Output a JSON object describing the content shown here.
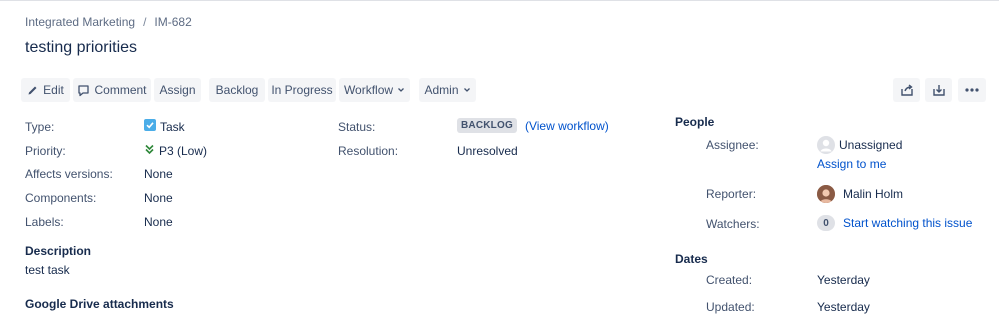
{
  "breadcrumb": {
    "project": "Integrated Marketing",
    "issue_key": "IM-682"
  },
  "issue": {
    "title": "testing priorities"
  },
  "toolbar": {
    "edit": "Edit",
    "comment": "Comment",
    "assign": "Assign",
    "backlog": "Backlog",
    "in_progress": "In Progress",
    "workflow": "Workflow",
    "admin": "Admin"
  },
  "details": {
    "type_label": "Type:",
    "type_value": "Task",
    "priority_label": "Priority:",
    "priority_value": "P3 (Low)",
    "affects_label": "Affects versions:",
    "affects_value": "None",
    "components_label": "Components:",
    "components_value": "None",
    "labels_label": "Labels:",
    "labels_value": "None",
    "status_label": "Status:",
    "status_value": "BACKLOG",
    "view_workflow": "(View workflow)",
    "resolution_label": "Resolution:",
    "resolution_value": "Unresolved"
  },
  "description": {
    "heading": "Description",
    "text": "test task"
  },
  "gdrive": {
    "heading": "Google Drive attachments"
  },
  "people": {
    "heading": "People",
    "assignee_label": "Assignee:",
    "assignee_value": "Unassigned",
    "assign_to_me": "Assign to me",
    "reporter_label": "Reporter:",
    "reporter_value": "Malin Holm",
    "watchers_label": "Watchers:",
    "watchers_count": "0",
    "watch_link": "Start watching this issue"
  },
  "dates": {
    "heading": "Dates",
    "created_label": "Created:",
    "created_value": "Yesterday",
    "updated_label": "Updated:",
    "updated_value": "Yesterday"
  },
  "colors": {
    "link": "#0052cc",
    "task_icon": "#4bade8",
    "priority_low": "#2d8738",
    "button_bg": "#f4f5f7"
  }
}
